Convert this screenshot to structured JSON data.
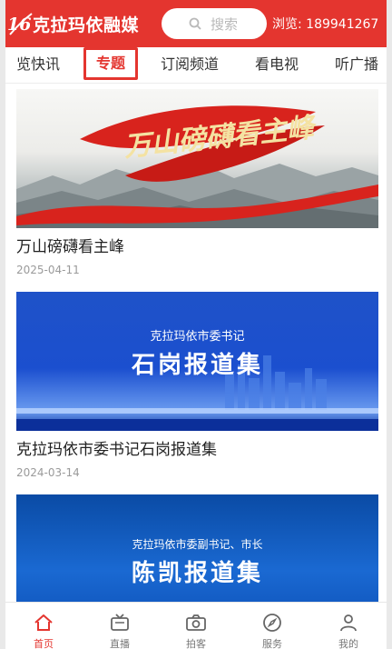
{
  "header": {
    "logo_text": "克拉玛依融媒",
    "search_placeholder": "搜索",
    "views_label": "浏览:",
    "views_count": "189941267"
  },
  "nav": {
    "tabs": [
      {
        "label": "览快讯"
      },
      {
        "label": "专题"
      },
      {
        "label": "订阅频道"
      },
      {
        "label": "看电视"
      },
      {
        "label": "听广播"
      }
    ],
    "active_index": 1
  },
  "feed": {
    "items": [
      {
        "banner_text": "万山磅礴看主峰",
        "title": "万山磅礴看主峰",
        "date": "2025-04-11"
      },
      {
        "banner_small": "克拉玛依市委书记",
        "banner_big": "石岗报道集",
        "title": "克拉玛依市委书记石岗报道集",
        "date": "2024-03-14"
      },
      {
        "banner_small": "克拉玛依市委副书记、市长",
        "banner_big": "陈凯报道集"
      }
    ]
  },
  "bottom_nav": {
    "items": [
      {
        "label": "首页",
        "icon": "home-icon"
      },
      {
        "label": "直播",
        "icon": "tv-icon"
      },
      {
        "label": "拍客",
        "icon": "camera-icon"
      },
      {
        "label": "服务",
        "icon": "compass-icon"
      },
      {
        "label": "我的",
        "icon": "user-icon"
      }
    ],
    "active_index": 0
  },
  "colors": {
    "brand_red": "#e4352f",
    "banner_blue": "#1b4fcf"
  }
}
